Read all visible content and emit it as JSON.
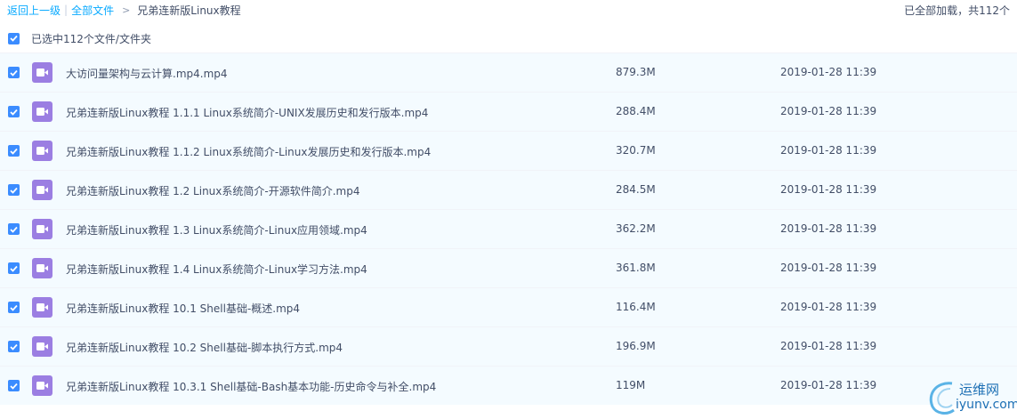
{
  "breadcrumb": {
    "back": "返回上一级",
    "all_files": "全部文件",
    "current": "兄弟连新版Linux教程"
  },
  "status": {
    "loaded": "已全部加载，共112个"
  },
  "selection": {
    "label": "已选中112个文件/文件夹"
  },
  "files": [
    {
      "name": "大访问量架构与云计算.mp4.mp4",
      "size": "879.3M",
      "date": "2019-01-28 11:39"
    },
    {
      "name": "兄弟连新版Linux教程 1.1.1 Linux系统简介-UNIX发展历史和发行版本.mp4",
      "size": "288.4M",
      "date": "2019-01-28 11:39"
    },
    {
      "name": "兄弟连新版Linux教程 1.1.2 Linux系统简介-Linux发展历史和发行版本.mp4",
      "size": "320.7M",
      "date": "2019-01-28 11:39"
    },
    {
      "name": "兄弟连新版Linux教程 1.2 Linux系统简介-开源软件简介.mp4",
      "size": "284.5M",
      "date": "2019-01-28 11:39"
    },
    {
      "name": "兄弟连新版Linux教程 1.3 Linux系统简介-Linux应用领域.mp4",
      "size": "362.2M",
      "date": "2019-01-28 11:39"
    },
    {
      "name": "兄弟连新版Linux教程 1.4 Linux系统简介-Linux学习方法.mp4",
      "size": "361.8M",
      "date": "2019-01-28 11:39"
    },
    {
      "name": "兄弟连新版Linux教程 10.1 Shell基础-概述.mp4",
      "size": "116.4M",
      "date": "2019-01-28 11:39"
    },
    {
      "name": "兄弟连新版Linux教程 10.2 Shell基础-脚本执行方式.mp4",
      "size": "196.9M",
      "date": "2019-01-28 11:39"
    },
    {
      "name": "兄弟连新版Linux教程 10.3.1 Shell基础-Bash基本功能-历史命令与补全.mp4",
      "size": "119M",
      "date": "2019-01-28 11:39"
    }
  ],
  "watermark": {
    "title": "运维网",
    "url": "iyunv.com"
  },
  "colors": {
    "link": "#09aaff",
    "checkbox": "#3b8cff",
    "video_icon": "#9b7ee2",
    "row_bg": "#f4fbff",
    "text": "#424e67"
  },
  "icons": {
    "checkbox": "checkmark-icon",
    "file": "video-file-icon"
  }
}
